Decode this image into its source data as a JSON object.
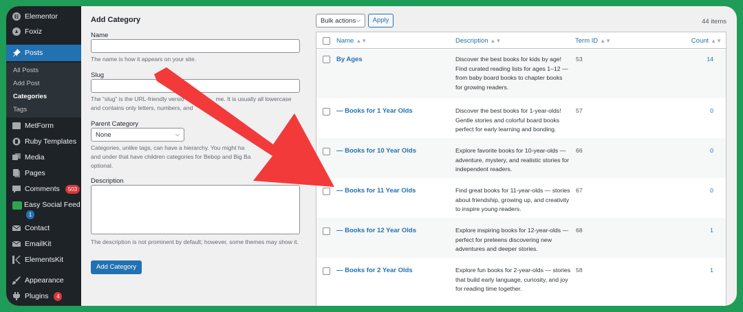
{
  "sidebar": {
    "items": [
      {
        "label": "Elementor",
        "icon": "elementor-icon"
      },
      {
        "label": "Foxiz",
        "icon": "foxiz-icon"
      },
      {
        "label": "Posts",
        "icon": "pin-icon"
      },
      {
        "label": "MetForm",
        "icon": "metform-icon"
      },
      {
        "label": "Ruby Templates",
        "icon": "ruby-icon"
      },
      {
        "label": "Media",
        "icon": "media-icon"
      },
      {
        "label": "Pages",
        "icon": "pages-icon"
      },
      {
        "label": "Comments",
        "icon": "comment-icon",
        "badge": "503"
      },
      {
        "label": "Easy Social Feed",
        "icon": "social-feed-icon",
        "badge": "1"
      },
      {
        "label": "Contact",
        "icon": "mail-icon"
      },
      {
        "label": "EmailKit",
        "icon": "envelope-icon"
      },
      {
        "label": "ElementsKit",
        "icon": "elementskit-icon"
      },
      {
        "label": "Appearance",
        "icon": "brush-icon"
      },
      {
        "label": "Plugins",
        "icon": "plugin-icon",
        "badge": "4"
      }
    ],
    "submenu": [
      "All Posts",
      "Add Post",
      "Categories",
      "Tags"
    ]
  },
  "form": {
    "title": "Add Category",
    "name_label": "Name",
    "name_help": "The name is how it appears on your site.",
    "slug_label": "Slug",
    "slug_help_1": "The “slug” is the URL-friendly versio",
    "slug_help_1b": "me. It is usually all lowercase",
    "slug_help_2": "and contains only letters, numbers, and",
    "parent_label": "Parent Category",
    "parent_value": "None",
    "parent_help_1": "Categories, unlike tags, can have a hierarchy. You might ha",
    "parent_help_2": "and under that have children categories for Bebop and Big Ba",
    "parent_help_3": "optional.",
    "desc_label": "Description",
    "desc_help": "The description is not prominent by default; however, some themes may show it.",
    "submit": "Add Category"
  },
  "table": {
    "bulk_actions": "Bulk actions",
    "apply": "Apply",
    "items_count": "44 items",
    "columns": {
      "name": "Name",
      "description": "Description",
      "term_id": "Term ID",
      "count": "Count"
    },
    "rows": [
      {
        "name": "By Ages",
        "desc": "Discover the best books for kids by age! Find curated reading lists for ages 1–12 — from baby board books to chapter books for growing readers.",
        "id": "53",
        "count": "14"
      },
      {
        "name": "— Books for 1 Year Olds",
        "desc": "Discover the best books for 1-year-olds! Gentle stories and colorful board books perfect for early learning and bonding.",
        "id": "57",
        "count": "0"
      },
      {
        "name": "— Books for 10 Year Olds",
        "desc": "Explore favorite books for 10-year-olds — adventure, mystery, and realistic stories for independent readers.",
        "id": "66",
        "count": "0"
      },
      {
        "name": "— Books for 11 Year Olds",
        "desc": "Find great books for 11-year-olds — stories about friendship, growing up, and creativity to inspire young readers.",
        "id": "67",
        "count": "0"
      },
      {
        "name": "— Books for 12 Year Olds",
        "desc": "Explore inspiring books for 12-year-olds — perfect for preteens discovering new adventures and deeper stories.",
        "id": "68",
        "count": "1"
      },
      {
        "name": "— Books for 2 Year Olds",
        "desc": "Explore fun books for 2-year-olds — stories that build early language, curiosity, and joy for reading time together.",
        "id": "58",
        "count": "1"
      }
    ]
  },
  "colors": {
    "accent": "#2271b1",
    "arrow": "#f23a3a",
    "frame": "#1f9c57",
    "sidebar": "#1d2327"
  }
}
